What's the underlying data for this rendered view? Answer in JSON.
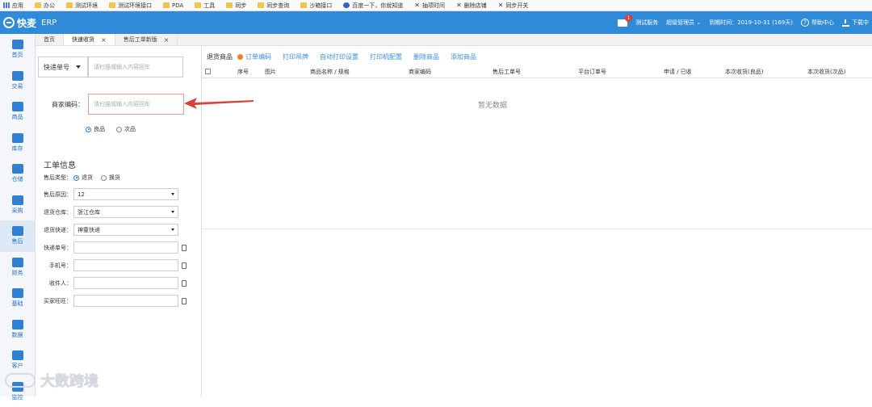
{
  "bookmarks": [
    {
      "label": "应用",
      "icon": "apps-grid-icon"
    },
    {
      "label": "办公",
      "icon": "folder-icon"
    },
    {
      "label": "测试环境",
      "icon": "folder-icon"
    },
    {
      "label": "测试环境接口",
      "icon": "folder-icon"
    },
    {
      "label": "PDA",
      "icon": "folder-icon"
    },
    {
      "label": "工具",
      "icon": "folder-icon"
    },
    {
      "label": "同步",
      "icon": "folder-icon"
    },
    {
      "label": "同步查询",
      "icon": "folder-icon"
    },
    {
      "label": "沙箱接口",
      "icon": "folder-icon"
    },
    {
      "label": "百度一下，你就知道",
      "icon": "baidu-paw-icon"
    },
    {
      "label": "抽项时间",
      "icon": "x-tool-icon"
    },
    {
      "label": "删除店铺",
      "icon": "x-tool-icon"
    },
    {
      "label": "同步开关",
      "icon": "x-tool-icon"
    }
  ],
  "header": {
    "brand": "快麦",
    "product": "ERP",
    "mail_badge": "1",
    "company": "测试服务",
    "user": "超级管理员",
    "expiry": "到期时间：2019-10-31 (169天)",
    "help": "帮助中心",
    "download": "下载中"
  },
  "leftnav": [
    {
      "label": "首页",
      "icon": "home-icon"
    },
    {
      "label": "交易",
      "icon": "clipboard-icon"
    },
    {
      "label": "商品",
      "icon": "box-icon"
    },
    {
      "label": "库存",
      "icon": "inventory-icon"
    },
    {
      "label": "仓储",
      "icon": "truck-icon"
    },
    {
      "label": "采购",
      "icon": "cart-icon"
    },
    {
      "label": "售后",
      "icon": "after-sales-icon",
      "active": true
    },
    {
      "label": "财务",
      "icon": "finance-icon"
    },
    {
      "label": "基础",
      "icon": "gear-icon"
    },
    {
      "label": "数据",
      "icon": "chart-icon"
    },
    {
      "label": "客户",
      "icon": "user-icon"
    },
    {
      "label": "监控",
      "icon": "monitor-icon"
    }
  ],
  "tabs": [
    {
      "label": "首页",
      "closable": false,
      "active": false
    },
    {
      "label": "快速收货",
      "closable": true,
      "active": true
    },
    {
      "label": "售后工单新版",
      "closable": true,
      "active": false
    }
  ],
  "scan": {
    "type_select": "快递单号",
    "tracking_placeholder": "请扫描或输入内容回车",
    "merchant_code_label": "商家编码：",
    "merchant_code_placeholder": "请扫描或输入内容回车",
    "quality_options": [
      "良品",
      "次品"
    ],
    "quality_selected": "良品"
  },
  "ticket": {
    "title": "工单信息",
    "aftersale_type_label": "售后类型：",
    "aftersale_type_options": [
      "退货",
      "换货"
    ],
    "aftersale_type_selected": "退货",
    "reason_label": "售后原因：",
    "reason_value": "12",
    "warehouse_label": "退货仓库：",
    "warehouse_value": "浙江仓库",
    "express_label": "退货快递：",
    "express_value": "神童快递",
    "tracking_label": "快递单号：",
    "phone_label": "手机号：",
    "receiver_label": "收件人：",
    "buyer_label": "买家旺旺："
  },
  "toolbar": {
    "label": "退货商品",
    "order_code": "订单编码",
    "print_tag": "打印吊牌",
    "auto_print": "自动打印设置",
    "printer_config": "打印机配置",
    "delete_item": "删除商品",
    "add_item": "添加商品"
  },
  "table": {
    "columns": [
      "序号",
      "图片",
      "商品名称 / 规格",
      "商家编码",
      "售后工单号",
      "平台订单号",
      "申请 / 已收",
      "本次收货(良品)",
      "本次收货(次品)"
    ],
    "empty": "暂无数据"
  },
  "watermark": "大数跨境",
  "colors": {
    "header": "#2f8ad8",
    "link": "#3a8de0",
    "arrow": "#d9413a"
  }
}
